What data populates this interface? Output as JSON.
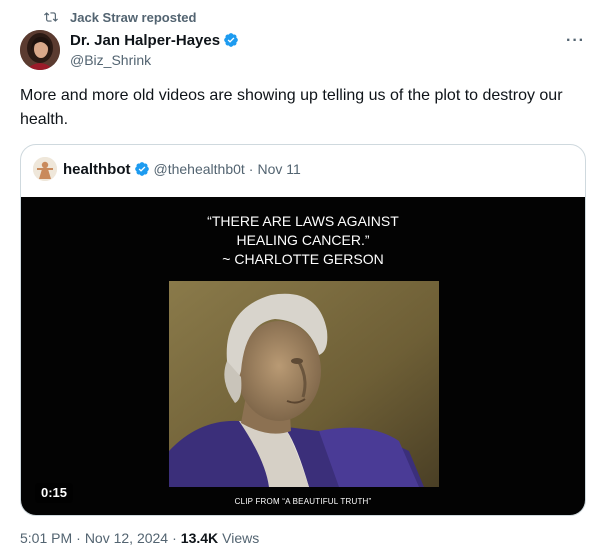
{
  "repost": {
    "icon": "repost-icon",
    "text": "Jack Straw reposted"
  },
  "tweet": {
    "author_name": "Dr. Jan Halper-Hayes",
    "author_handle": "@Biz_Shrink",
    "verified_icon": "verified-badge-icon",
    "more_icon": "more-options-icon",
    "more_label": "···",
    "text": "More and more old videos are showing up telling us of the plot to destroy our health."
  },
  "quote": {
    "author_name": "healthbot",
    "author_handle": "@thehealthb0t",
    "separator": "·",
    "date": "Nov 11",
    "video": {
      "caption_line1": "“THERE ARE LAWS AGAINST",
      "caption_line2": "HEALING CANCER.”",
      "caption_line3": "~ CHARLOTTE GERSON",
      "duration": "0:15",
      "clip_label": "CLIP FROM “A BEAUTIFUL TRUTH”"
    }
  },
  "meta": {
    "time": "5:01 PM",
    "separator": "·",
    "date": "Nov 12, 2024",
    "views_count": "13.4K",
    "views_label": "Views"
  },
  "colors": {
    "verified": "#1d9bf0",
    "secondary_text": "#536471",
    "primary_text": "#0f1419",
    "border": "#cfd9de"
  }
}
